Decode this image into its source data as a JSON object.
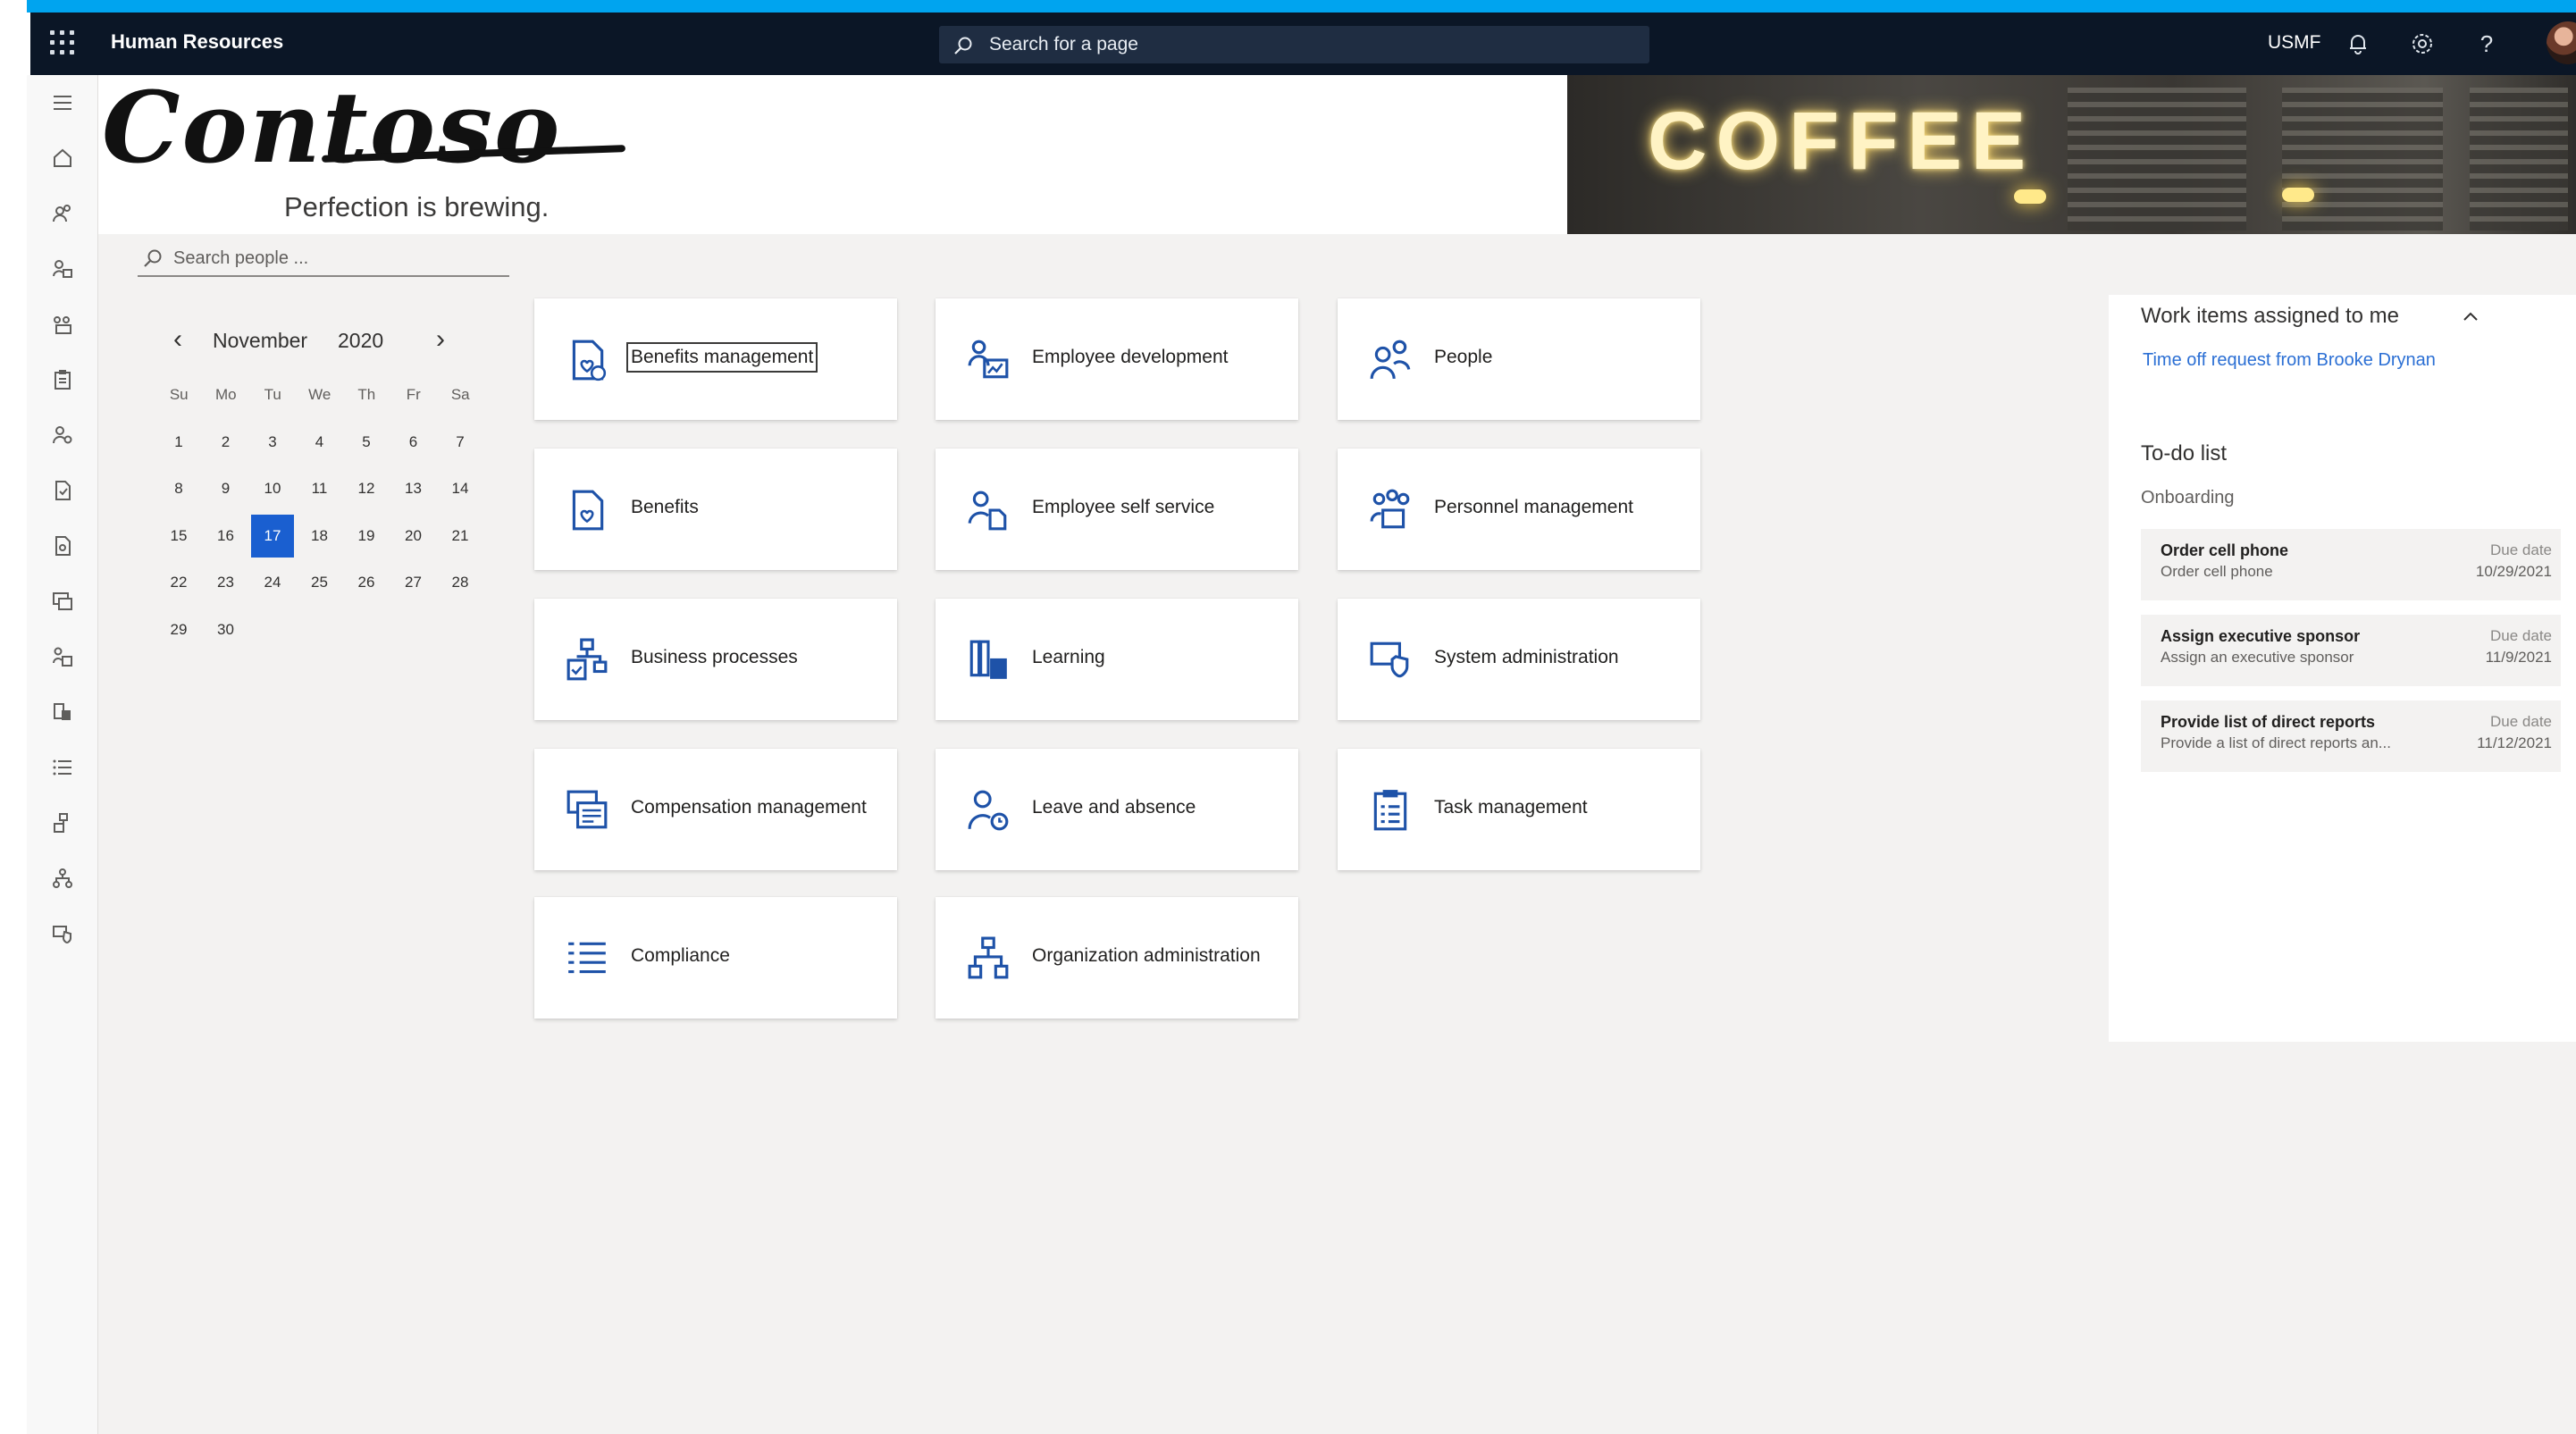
{
  "topbar": {
    "app_title": "Human Resources",
    "search_placeholder": "Search for a page",
    "company": "USMF",
    "icons": [
      "waffle-icon",
      "bell-icon",
      "gear-icon",
      "help-icon",
      "avatar"
    ]
  },
  "left_rail": {
    "icons": [
      "hamburger-icon",
      "home-icon",
      "people-icon",
      "person-tag-icon",
      "group-icon",
      "clipboard-icon",
      "person-badge-icon",
      "document-icon",
      "document-cert-icon",
      "compensation-icon",
      "person-report-icon",
      "book-icon",
      "list-icon",
      "organization-icon",
      "hierarchy-icon",
      "shield-icon"
    ]
  },
  "branding": {
    "logo_text": "Contoso",
    "tagline": "Perfection is brewing.",
    "banner_text": "COFFEE"
  },
  "people_search": {
    "placeholder": "Search people ..."
  },
  "calendar": {
    "month": "November",
    "year": "2020",
    "prev": "‹",
    "next": "›",
    "weekdays": [
      "Su",
      "Mo",
      "Tu",
      "We",
      "Th",
      "Fr",
      "Sa"
    ],
    "selected_day": "17",
    "start_offset": 0,
    "days": [
      "1",
      "2",
      "3",
      "4",
      "5",
      "6",
      "7",
      "8",
      "9",
      "10",
      "11",
      "12",
      "13",
      "14",
      "15",
      "16",
      "17",
      "18",
      "19",
      "20",
      "21",
      "22",
      "23",
      "24",
      "25",
      "26",
      "27",
      "28",
      "29",
      "30"
    ]
  },
  "tiles": [
    {
      "label": "Benefits management",
      "icon": "benefits-management-icon",
      "focused": true
    },
    {
      "label": "Employee development",
      "icon": "employee-development-icon"
    },
    {
      "label": "People",
      "icon": "people-icon"
    },
    {
      "label": "Benefits",
      "icon": "benefits-icon"
    },
    {
      "label": "Employee self service",
      "icon": "employee-self-service-icon"
    },
    {
      "label": "Personnel management",
      "icon": "personnel-management-icon"
    },
    {
      "label": "Business processes",
      "icon": "business-processes-icon"
    },
    {
      "label": "Learning",
      "icon": "learning-icon"
    },
    {
      "label": "System administration",
      "icon": "system-administration-icon"
    },
    {
      "label": "Compensation management",
      "icon": "compensation-management-icon"
    },
    {
      "label": "Leave and absence",
      "icon": "leave-and-absence-icon"
    },
    {
      "label": "Task management",
      "icon": "task-management-icon"
    },
    {
      "label": "Compliance",
      "icon": "compliance-icon"
    },
    {
      "label": "Organization administration",
      "icon": "organization-administration-icon"
    }
  ],
  "work_items": {
    "title": "Work items assigned to me",
    "link": "Time off request from Brooke Drynan"
  },
  "todo": {
    "title": "To-do list",
    "group": "Onboarding",
    "items": [
      {
        "title": "Order cell phone",
        "desc": "Order cell phone",
        "due_label": "Due date",
        "due": "10/29/2021"
      },
      {
        "title": "Assign executive sponsor",
        "desc": "Assign an executive sponsor",
        "due_label": "Due date",
        "due": "11/9/2021"
      },
      {
        "title": "Provide list of direct reports",
        "desc": "Provide a list of direct reports an...",
        "due_label": "Due date",
        "due": "11/12/2021"
      }
    ]
  },
  "colors": {
    "accent_bar": "#00a4ef",
    "topbar": "#0b1626",
    "tile_icon": "#1e52a8",
    "selected_day": "#1a5fd0",
    "link": "#2b6fd4"
  }
}
